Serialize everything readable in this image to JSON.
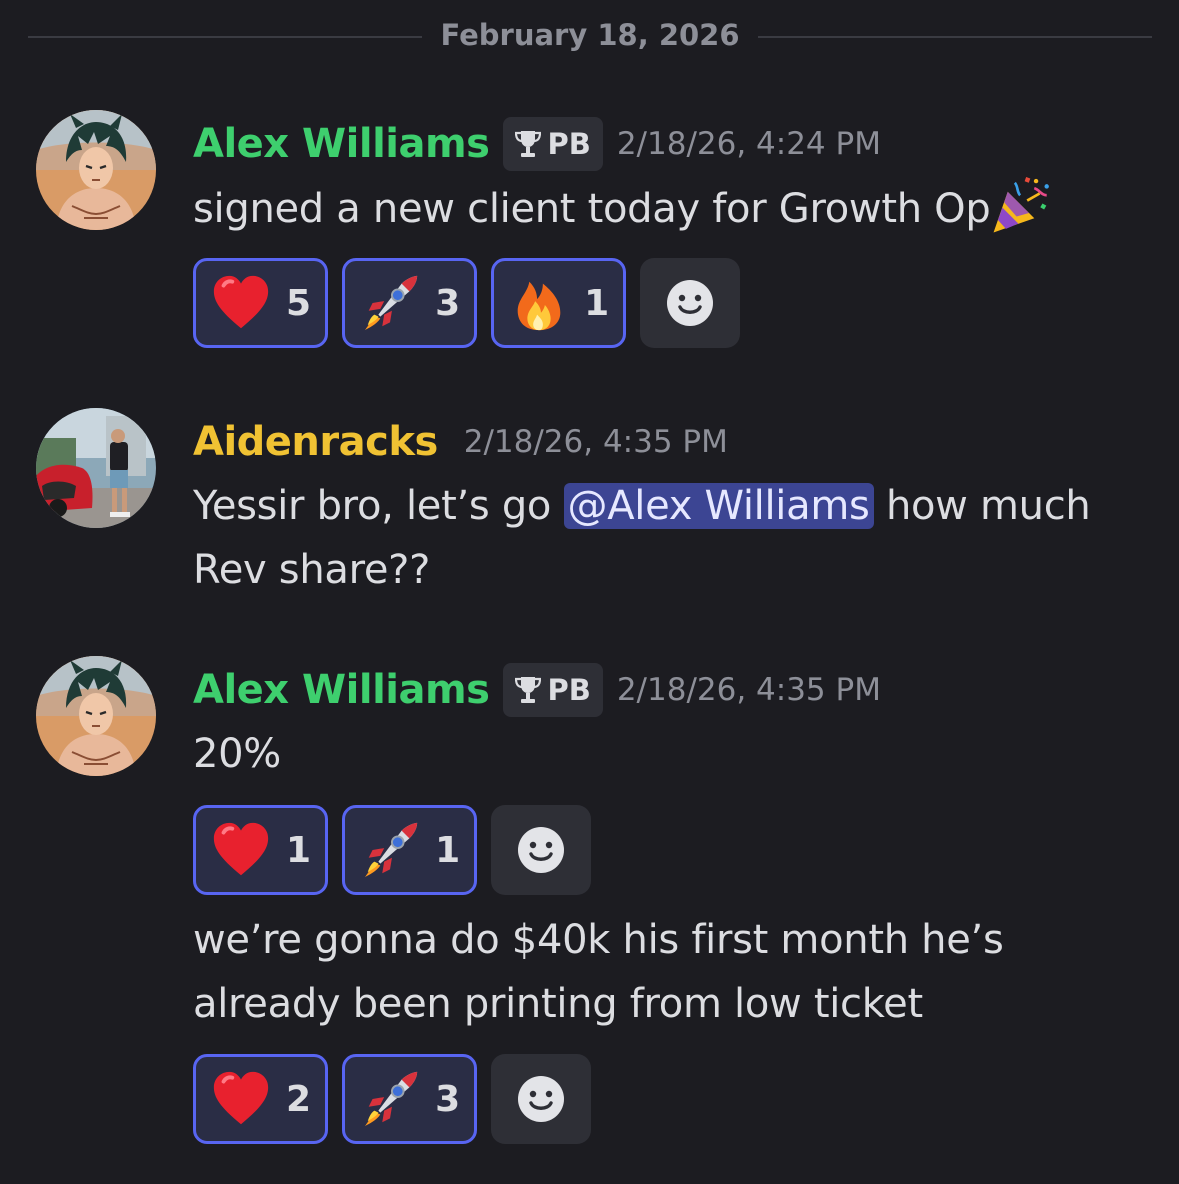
{
  "date_divider": "February 18, 2026",
  "colors": {
    "background": "#1c1c21",
    "alex_name": "#3ecf6e",
    "aiden_name": "#f0c233",
    "reaction_border": "#5865f2",
    "mention_bg": "#3c4593"
  },
  "messages": [
    {
      "author": "Alex Williams",
      "tag": "PB",
      "tag_icon": "trophy-icon",
      "timestamp": "2/18/26, 4:24 PM",
      "text": "signed a new client today for Growth Op",
      "trailing_emoji": "party-popper-icon",
      "reactions": [
        {
          "emoji": "heart-icon",
          "count": "5"
        },
        {
          "emoji": "rocket-icon",
          "count": "3"
        },
        {
          "emoji": "fire-icon",
          "count": "1"
        }
      ]
    },
    {
      "author": "Aidenracks",
      "timestamp": "2/18/26, 4:35 PM",
      "text_before_mention": "Yessir bro, let’s go",
      "mention": "@Alex Williams",
      "text_after_mention": "how much",
      "text_line2": "Rev share??"
    },
    {
      "author": "Alex Williams",
      "tag": "PB",
      "tag_icon": "trophy-icon",
      "timestamp": "2/18/26, 4:35 PM",
      "text": "20%",
      "reactions": [
        {
          "emoji": "heart-icon",
          "count": "1"
        },
        {
          "emoji": "rocket-icon",
          "count": "1"
        }
      ]
    },
    {
      "text_line1": "we’re gonna do $40k his first month he’s",
      "text_line2": "already been printing from low ticket",
      "reactions": [
        {
          "emoji": "heart-icon",
          "count": "2"
        },
        {
          "emoji": "rocket-icon",
          "count": "3"
        }
      ]
    }
  ]
}
